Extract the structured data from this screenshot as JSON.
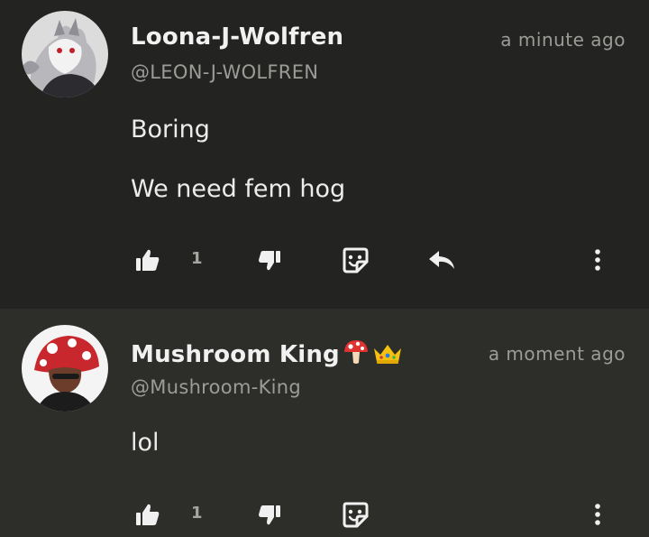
{
  "comments": [
    {
      "display_name": "Loona-J-Wolfren",
      "handle": "@LEON-J-WOLFREN",
      "time": "a minute ago",
      "body": [
        "Boring",
        "We need fem hog"
      ],
      "like_count": "1"
    },
    {
      "display_name": "Mushroom King",
      "handle": "@Mushroom-King",
      "time": "a moment ago",
      "body": [
        "lol"
      ],
      "like_count": "1"
    }
  ],
  "icons": {
    "like": "thumbs-up-icon",
    "dislike": "thumbs-down-icon",
    "sticker": "sticker-icon",
    "reply": "reply-icon",
    "more": "more-vertical-icon"
  },
  "colors": {
    "background": "#2a2a27",
    "card_primary": "#232321",
    "card_secondary": "#2d2d2a",
    "text_primary": "#ececec",
    "text_secondary": "#9b9b98"
  }
}
